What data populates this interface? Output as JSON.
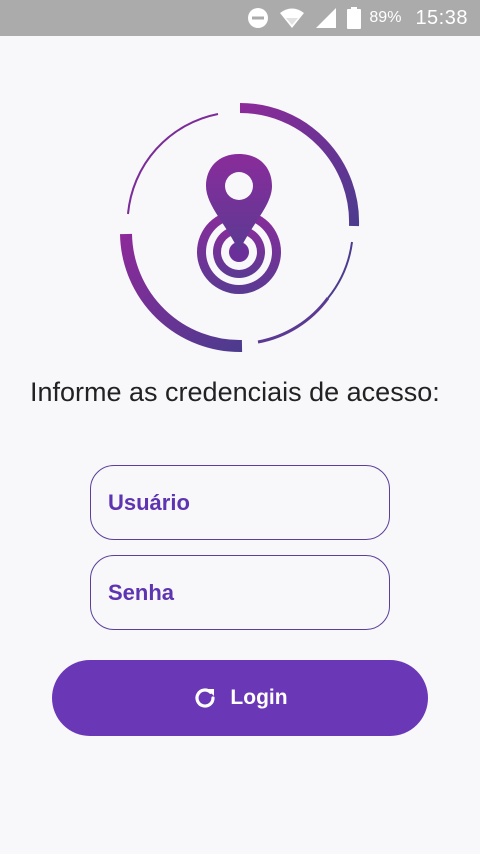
{
  "status_bar": {
    "battery_percent": "89%",
    "time": "15:38",
    "icons": [
      "do-not-disturb-icon",
      "wifi-icon",
      "signal-icon",
      "battery-icon"
    ]
  },
  "logo": {
    "icon": "location-target-logo-icon"
  },
  "prompt": {
    "text": "Informe as credenciais de acesso:"
  },
  "form": {
    "username_placeholder": "Usuário",
    "username_value": "",
    "password_placeholder": "Senha",
    "password_value": ""
  },
  "login_button": {
    "label": "Login",
    "icon": "refresh-icon"
  },
  "colors": {
    "accent": "#6a37b7",
    "field_text": "#5e35b1",
    "field_border": "#5b3f99",
    "status_bar": "#ababab",
    "background": "#f8f7fa"
  }
}
